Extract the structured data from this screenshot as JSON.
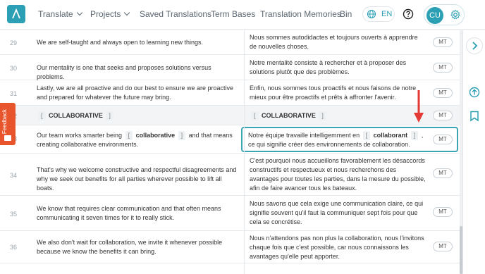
{
  "nav": {
    "translate": "Translate",
    "projects": "Projects",
    "saved": "Saved Translations",
    "termbases": "Term Bases",
    "tm": "Translation Memories",
    "bin": "Bin",
    "lang": "EN",
    "user_initials": "CU"
  },
  "feedback_label": "Feedback",
  "mt_label": "MT",
  "rows": [
    {
      "num": "29",
      "src": "We are self-taught and always open to learning new things.",
      "tgt": "Nous sommes autodidactes et toujours ouverts à apprendre de nouvelles choses."
    },
    {
      "num": "30",
      "src": "Our mentality is one that seeks and proposes solutions versus problems.",
      "tgt": "Notre mentalité consiste à rechercher et à proposer des solutions plutôt que des problèmes."
    },
    {
      "num": "31",
      "src": "Lastly, we are all proactive and do our best to ensure we are proactive and prepared for whatever the future may bring.",
      "tgt": "Enfin, nous sommes tous proactifs et nous faisons de notre mieux pour être proactifs et prêts à affronter l'avenir."
    },
    {
      "num": "32",
      "src_tag": "COLLABORATIVE",
      "tgt_tag": "COLLABORATIVE"
    },
    {
      "num": "33",
      "src_a": "Our team works smarter being",
      "src_tag": "collaborative",
      "src_b": "and that means creating collaborative environments.",
      "tgt_a": "Notre équipe travaille intelligemment en",
      "tgt_tag": "collaborant",
      "tgt_b": ", ce qui signifie créer des environnements de collaboration."
    },
    {
      "num": "34",
      "src": "That's why we welcome constructive and respectful disagreements and why we seek out benefits for all parties wherever possible to lift all boats.",
      "tgt": "C'est pourquoi nous accueillons favorablement les désaccords constructifs et respectueux et nous recherchons des avantages pour toutes les parties, dans la mesure du possible, afin de faire avancer tous les bateaux."
    },
    {
      "num": "35",
      "src": "We know that requires clear communication and that often means communicating it seven times for it to really stick.",
      "tgt": "Nous savons que cela exige une communication claire, ce qui signifie souvent qu'il faut la communiquer sept fois pour que cela se concrétise."
    },
    {
      "num": "36",
      "src": "We also don't wait for collaboration, we invite it whenever possible because we know the benefits it can bring.",
      "tgt": "Nous n'attendons pas non plus la collaboration, nous l'invitons chaque fois que c'est possible, car nous connaissons les avantages qu'elle peut apporter."
    }
  ],
  "colors": {
    "accent": "#2b9fb3",
    "annotation": "#e53935",
    "feedback": "#e8542b"
  }
}
